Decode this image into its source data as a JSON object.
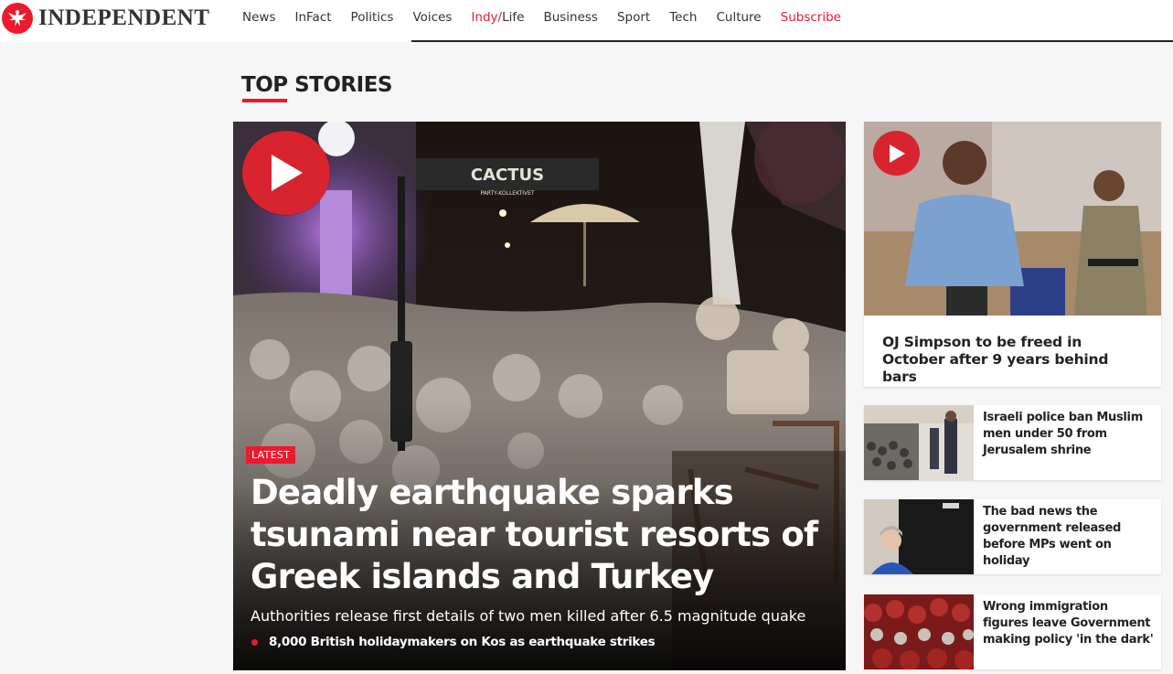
{
  "header": {
    "logo_text": "INDEPENDENT",
    "nav": [
      {
        "label": "News"
      },
      {
        "label": "InFact"
      },
      {
        "label": "Politics"
      },
      {
        "label": "Voices"
      },
      {
        "label_a": "Indy/",
        "label_b": "Life"
      },
      {
        "label": "Business"
      },
      {
        "label": "Sport"
      },
      {
        "label": "Tech"
      },
      {
        "label": "Culture"
      },
      {
        "label": "Subscribe"
      }
    ]
  },
  "section": {
    "title_a": "TOP",
    "title_b": " STORIES"
  },
  "hero": {
    "tag": "LATEST",
    "headline": "Deadly earthquake sparks tsunami near tourist resorts of Greek islands and Turkey",
    "standfirst": "Authorities release first details of two men killed after 6.5 magnitude quake",
    "related": "8,000 British holidaymakers on Kos as earthquake strikes",
    "sign_text": "CACTUS",
    "sign_subtext": "PARTY-KOLLEKTIVET"
  },
  "side": {
    "main_title": "OJ Simpson to be freed in October after 9 years behind bars",
    "items": [
      {
        "title": "Israeli police ban Muslim men under 50 from Jerusalem shrine"
      },
      {
        "title": "The bad news the government released before MPs went on holiday"
      },
      {
        "title": "Wrong immigration figures leave Government making policy 'in the dark'"
      }
    ]
  },
  "colors": {
    "brand_red": "#ec1a2e",
    "play_red": "#d7242f",
    "page_bg": "#f6f6f6",
    "text_dark": "#222222"
  },
  "icons": {
    "logo": "eagle-icon",
    "video": "play-icon",
    "related_bullet": "bullet-icon"
  }
}
